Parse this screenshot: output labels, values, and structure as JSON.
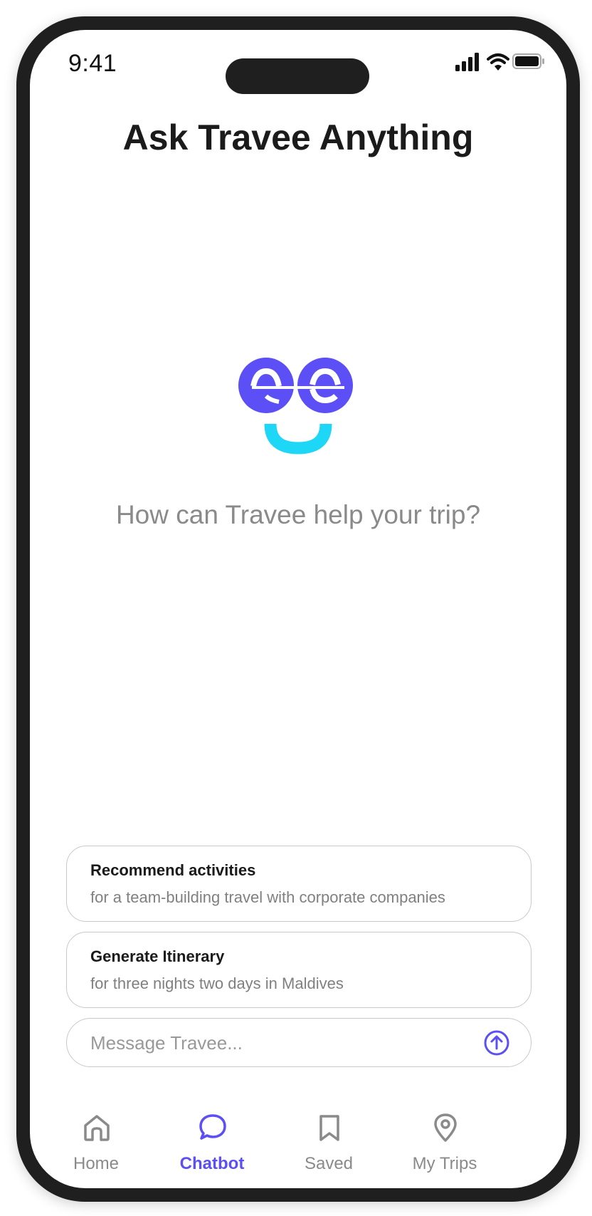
{
  "status_bar": {
    "time": "9:41"
  },
  "header": {
    "title": "Ask Travee Anything"
  },
  "hero": {
    "prompt": "How can Travee help your trip?"
  },
  "suggestions": [
    {
      "title": "Recommend activities",
      "subtitle": "for a team-building travel with corporate companies"
    },
    {
      "title": "Generate Itinerary",
      "subtitle": "for three nights two days in Maldives"
    }
  ],
  "composer": {
    "placeholder": "Message Travee..."
  },
  "tab_bar": {
    "items": [
      {
        "label": "Home",
        "icon": "home-icon",
        "active": false
      },
      {
        "label": "Chatbot",
        "icon": "chat-bubble-icon",
        "active": true
      },
      {
        "label": "Saved",
        "icon": "bookmark-icon",
        "active": false
      },
      {
        "label": "My Trips",
        "icon": "location-pin-icon",
        "active": false
      }
    ]
  },
  "colors": {
    "accent": "#5b4ff5",
    "logo_smile": "#1ed7f7",
    "text_muted": "#8a8a8a"
  }
}
